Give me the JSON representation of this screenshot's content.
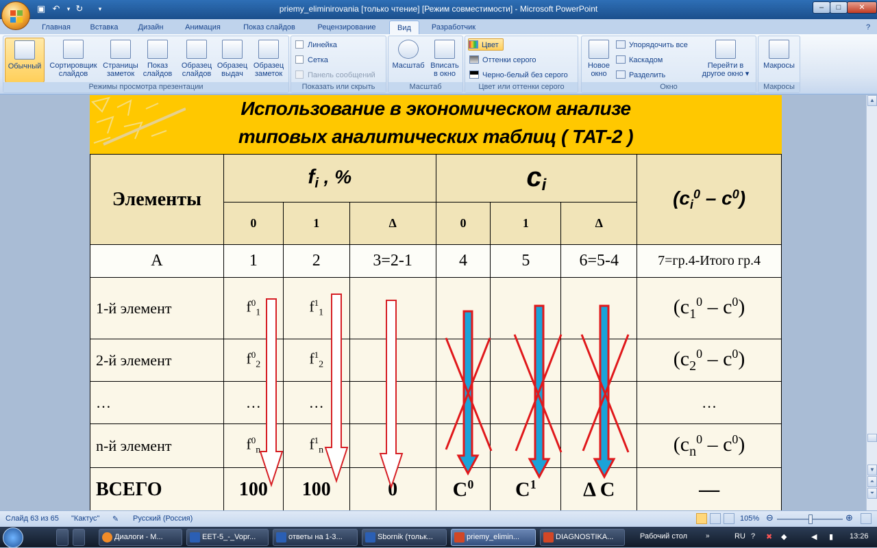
{
  "window": {
    "title": "priemy_eliminirovania [только чтение] [Режим совместимости] - Microsoft PowerPoint",
    "minimize": "–",
    "maximize": "□",
    "close": "✕"
  },
  "tabs": [
    "Главная",
    "Вставка",
    "Дизайн",
    "Анимация",
    "Показ слайдов",
    "Рецензирование",
    "Вид",
    "Разработчик"
  ],
  "active_tab": "Вид",
  "ribbon": {
    "views": {
      "label": "Режимы просмотра презентации",
      "normal": "Обычный",
      "sorter_1": "Сортировщик",
      "sorter_2": "слайдов",
      "notes_1": "Страницы",
      "notes_2": "заметок",
      "show_1": "Показ",
      "show_2": "слайдов",
      "master_1": "Образец",
      "master_2": "слайдов",
      "handout_1": "Образец",
      "handout_2": "выдач",
      "notesmaster_1": "Образец",
      "notesmaster_2": "заметок"
    },
    "showhide": {
      "label": "Показать или скрыть",
      "ruler": "Линейка",
      "grid": "Сетка",
      "msgbar": "Панель сообщений"
    },
    "zoom": {
      "label": "Масштаб",
      "zoom": "Масштаб",
      "fit_1": "Вписать",
      "fit_2": "в окно"
    },
    "color": {
      "label": "Цвет или оттенки серого",
      "color": "Цвет",
      "gray": "Оттенки серого",
      "bw": "Черно-белый без серого"
    },
    "window": {
      "label": "Окно",
      "new_1": "Новое",
      "new_2": "окно",
      "arrange": "Упорядочить все",
      "cascade": "Каскадом",
      "split": "Разделить",
      "switch_1": "Перейти в",
      "switch_2": "другое окно ▾"
    },
    "macros": {
      "label": "Макросы",
      "macros": "Макросы"
    }
  },
  "slide": {
    "title_line1": "Использование в экономическом анализе",
    "title_line2": "типовых аналитических таблиц ( ТАТ-2 )",
    "table": {
      "col_elements": "Элементы",
      "col_f_main": "f",
      "col_f_sub": "i",
      "col_f_suffix": " , %",
      "col_c_main": "c",
      "col_c_sub": "i",
      "col_diff": {
        "open": "(c",
        "sub": "i",
        "sup": "0",
        "mid": " – c",
        "sup2": "0",
        "close": ")"
      },
      "subheaders": [
        "0",
        "1",
        "Δ",
        "0",
        "1",
        "Δ"
      ],
      "index_row": [
        "А",
        "1",
        "2",
        "3=2-1",
        "4",
        "5",
        "6=5-4",
        "7=гр.4-Итого гр.4"
      ],
      "rows": [
        {
          "name": "1-й элемент",
          "f0": "1",
          "f1": "1",
          "dsub": "1"
        },
        {
          "name": "2-й элемент",
          "f0": "2",
          "f1": "2",
          "dsub": "2"
        },
        {
          "name": "…",
          "f0": "…",
          "f1": "…",
          "dsub": "…"
        },
        {
          "name": "n-й элемент",
          "f0": "n",
          "f1": "n",
          "dsub": "n"
        }
      ],
      "total": {
        "name": "ВСЕГО",
        "f0": "100",
        "f1": "100",
        "fd": "0",
        "c0": "С",
        "c0sup": "0",
        "c1": "С",
        "c1sup": "1",
        "cd": "Δ С",
        "diff": "—"
      }
    }
  },
  "status": {
    "slide": "Слайд 63 из 65",
    "theme": "\"Кактус\"",
    "lang": "Русский (Россия)",
    "zoom": "105%"
  },
  "taskbar": {
    "items": [
      "Диалоги - М...",
      "ЕЕТ-5_-_Vopr...",
      "ответы на 1-3...",
      "Sbornik (тольк...",
      "priemy_elimin...",
      "DIAGNOSTIKA..."
    ],
    "desktop": "Рабочий стол",
    "lang": "RU",
    "time": "13:26"
  },
  "colors": {
    "header_yellow": "#ffc800",
    "arrow_blue": "#1aa3d9",
    "arrow_red": "#e0181b"
  }
}
